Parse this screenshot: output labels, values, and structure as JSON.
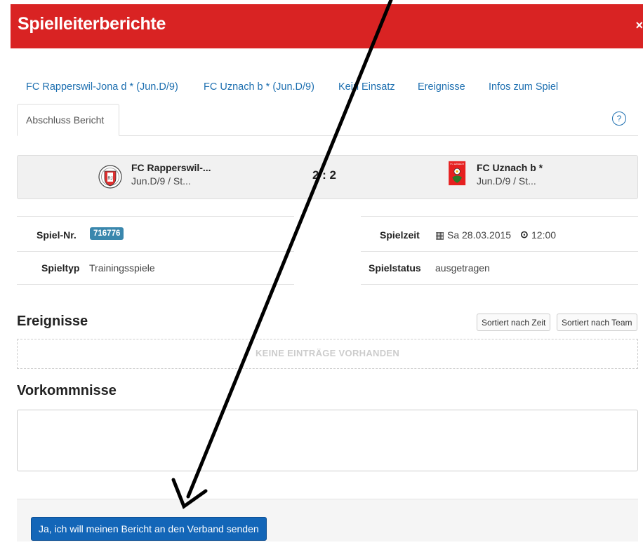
{
  "header": {
    "title": "Spielleiterberichte",
    "close_glyph": "×"
  },
  "nav": {
    "links": [
      "FC Rapperswil-Jona d * (Jun.D/9)",
      "FC Uznach b * (Jun.D/9)",
      "Kein Einsatz",
      "Ereignisse",
      "Infos zum Spiel"
    ],
    "active_tab": "Abschluss Bericht",
    "help": "?"
  },
  "match": {
    "home": {
      "name": "FC Rapperswil-...",
      "sub": "Jun.D/9 / St...",
      "logo": "rapperswil-jona-crest"
    },
    "score": "2 : 2",
    "away": {
      "name": "FC Uznach b *",
      "sub": "Jun.D/9 / St...",
      "logo": "uznach-crest",
      "logo_text": "FC UZNACH"
    }
  },
  "info": {
    "spiel_nr_label": "Spiel-Nr.",
    "spiel_nr": "716776",
    "spieltyp_label": "Spieltyp",
    "spieltyp": "Trainingsspiele",
    "spielzeit_label": "Spielzeit",
    "spielzeit_date": "Sa 28.03.2015",
    "spielzeit_time": "12:00",
    "spielstatus_label": "Spielstatus",
    "spielstatus": "ausgetragen"
  },
  "ereignisse": {
    "title": "Ereignisse",
    "sort_time": "Sortiert nach Zeit",
    "sort_team": "Sortiert nach Team",
    "empty": "KEINE EINTRÄGE VORHANDEN"
  },
  "vorkommnisse": {
    "title": "Vorkommnisse",
    "text": ""
  },
  "footer": {
    "send_label": "Ja, ich will meinen Bericht an den Verband senden"
  },
  "colors": {
    "header_red": "#d92323",
    "link_blue": "#1d6fb0",
    "button_blue": "#1366b8",
    "badge_blue": "#3a87ad"
  }
}
